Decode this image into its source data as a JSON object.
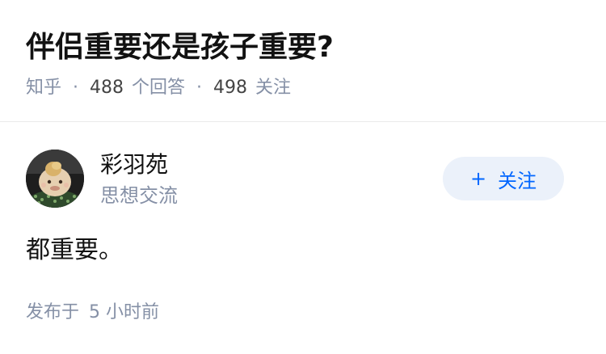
{
  "question": {
    "title": "伴侣重要还是孩子重要?",
    "source": "知乎",
    "answer_count": "488",
    "answer_label": "个回答",
    "follower_count": "498",
    "follower_label": "关注",
    "separator": "·"
  },
  "author": {
    "name": "彩羽苑",
    "bio": "思想交流",
    "follow_button_label": "关注",
    "follow_button_icon": "plus-icon"
  },
  "answer": {
    "content": "都重要。",
    "published_prefix": "发布于",
    "published_time": "5 小时前"
  },
  "colors": {
    "title": "#121212",
    "meta_gray": "#8590a6",
    "accent_blue": "#0066ff",
    "follow_bg": "#ebf1fa",
    "divider": "#ebebeb"
  }
}
